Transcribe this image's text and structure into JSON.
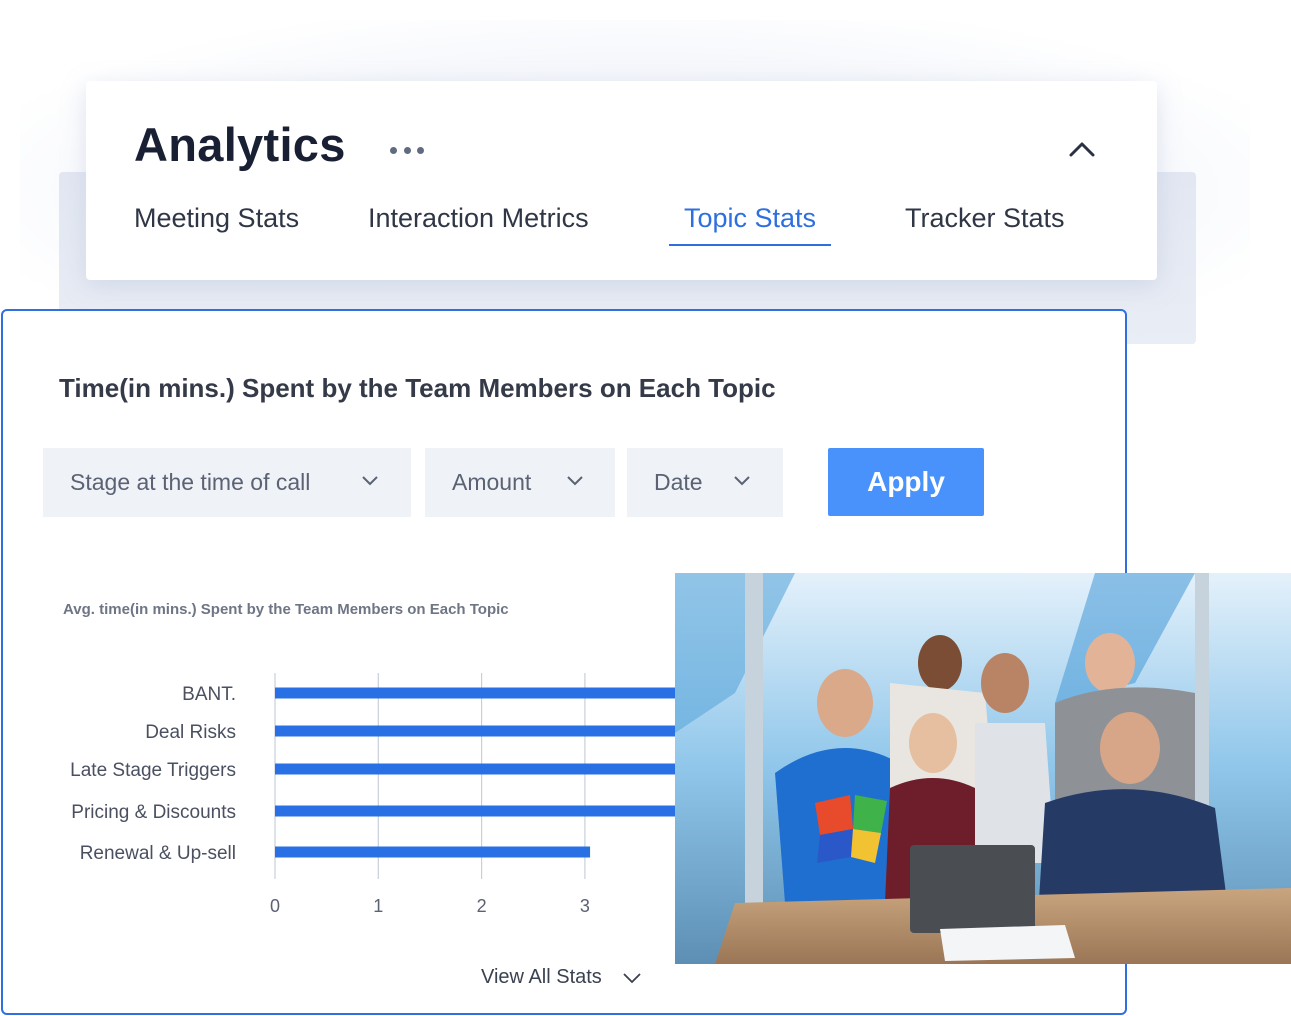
{
  "header": {
    "title": "Analytics",
    "more_icon": "more-horizontal-icon",
    "collapse_icon": "chevron-up-icon",
    "tabs": [
      {
        "label": "Meeting Stats",
        "active": false
      },
      {
        "label": "Interaction Metrics",
        "active": false
      },
      {
        "label": "Topic Stats",
        "active": true
      },
      {
        "label": "Tracker Stats",
        "active": false
      }
    ]
  },
  "panel": {
    "title": "Time(in mins.) Spent by the Team Members on Each Topic",
    "filters": [
      {
        "label": "Stage at the time of call",
        "icon": "chevron-down-icon"
      },
      {
        "label": "Amount",
        "icon": "chevron-down-icon"
      },
      {
        "label": "Date",
        "icon": "chevron-down-icon"
      }
    ],
    "apply_label": "Apply",
    "view_all_label": "View All Stats"
  },
  "colors": {
    "accent": "#2d6fe0",
    "bar": "#2870e3",
    "apply_button": "#4a92fb",
    "grid": "#c8cfdb"
  },
  "photo": {
    "description": "Photo of six colleagues cheering around a laptop at a conference table"
  },
  "chart_data": {
    "type": "bar",
    "orientation": "horizontal",
    "title": "Avg. time(in mins.) Spent by the Team Members on Each Topic",
    "xlabel": "",
    "ylabel": "",
    "categories": [
      "BANT.",
      "Deal Risks",
      "Late Stage Triggers",
      "Pricing & Discounts",
      "Renewal & Up-sell"
    ],
    "values": [
      4,
      4,
      4,
      4,
      3.05
    ],
    "note": "First four bars continue beyond the visible area (obscured by photo); values estimated",
    "x_ticks": [
      "0",
      "1",
      "2",
      "3"
    ],
    "xlim": [
      0,
      3.9
    ],
    "grid": true,
    "legend": "none"
  }
}
